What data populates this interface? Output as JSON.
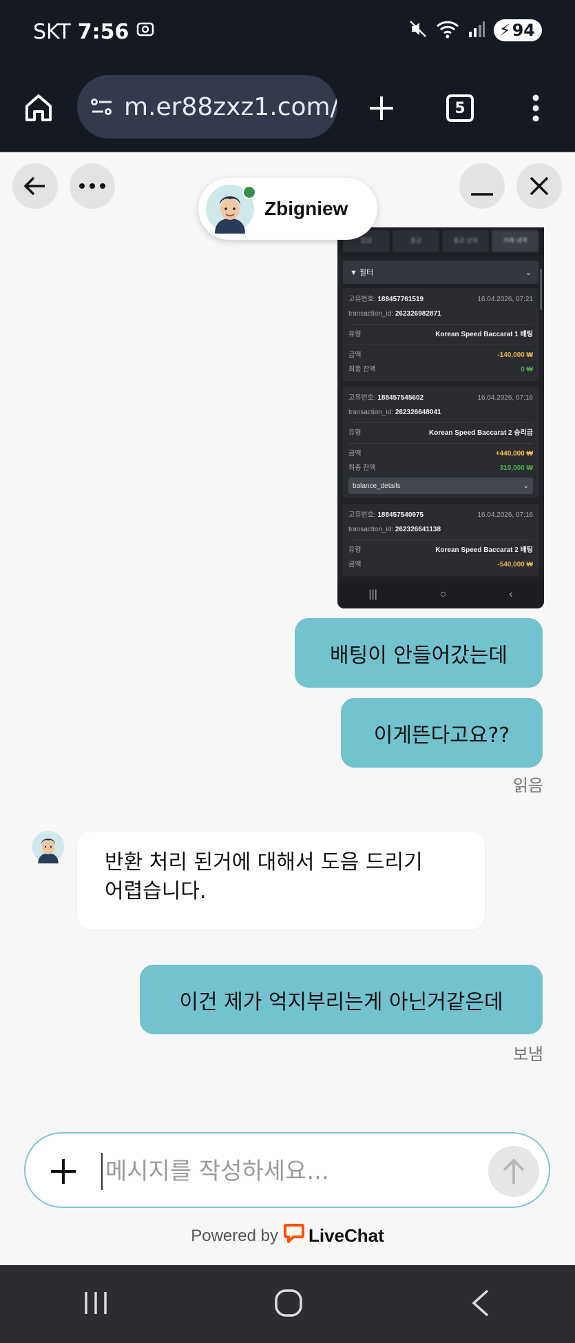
{
  "status_bar": {
    "carrier": "SKT",
    "time": "7:56",
    "battery": "94"
  },
  "browser": {
    "url": "m.er88zxz1.com/l",
    "tab_count": "5"
  },
  "chat_header": {
    "agent_name": "Zbigniew"
  },
  "screenshot": {
    "tabs": [
      "입금",
      "출금",
      "출금 상태",
      "거래 내역"
    ],
    "filter_label": "필터",
    "cards": [
      {
        "id_label": "고유번호:",
        "id": "188457761519",
        "date": "16.04.2026, 07:21",
        "tx_label": "transaction_id:",
        "tx": "262326982871",
        "type_label": "유형",
        "type": "Korean Speed Baccarat 1 배팅",
        "amount_label": "금액",
        "amount": "-140,000 ₩",
        "balance_label": "최종 잔액",
        "balance": "0 ₩"
      },
      {
        "id_label": "고유번호:",
        "id": "188457545602",
        "date": "16.04.2026, 07:16",
        "tx_label": "transaction_id:",
        "tx": "262326648041",
        "type_label": "유형",
        "type": "Korean Speed Baccarat 2 승리금",
        "amount_label": "금액",
        "amount": "+440,000 ₩",
        "balance_label": "최종 잔액",
        "balance": "310,000 ₩",
        "dropdown": "balance_details"
      },
      {
        "id_label": "고유번호:",
        "id": "188457540975",
        "date": "16.04.2026, 07:16",
        "tx_label": "transaction_id:",
        "tx": "262326641138",
        "type_label": "유형",
        "type": "Korean Speed Baccarat 2 배팅",
        "amount_label": "금액",
        "amount": "-540,000 ₩"
      }
    ]
  },
  "messages": {
    "out1": "배팅이 안들어갔는데",
    "out2": "이게뜬다고요??",
    "read_status": "읽음",
    "in1_line1": "반환 처리 된거에 대해서 도음 드리기",
    "in1_line2": "어렵습니다.",
    "out3": "이건 제가 억지부리는게 아닌거같은데",
    "sent_status": "보냄"
  },
  "composer": {
    "placeholder": "메시지를 작성하세요..."
  },
  "footer": {
    "powered_by": "Powered by",
    "brand": "LiveChat"
  }
}
